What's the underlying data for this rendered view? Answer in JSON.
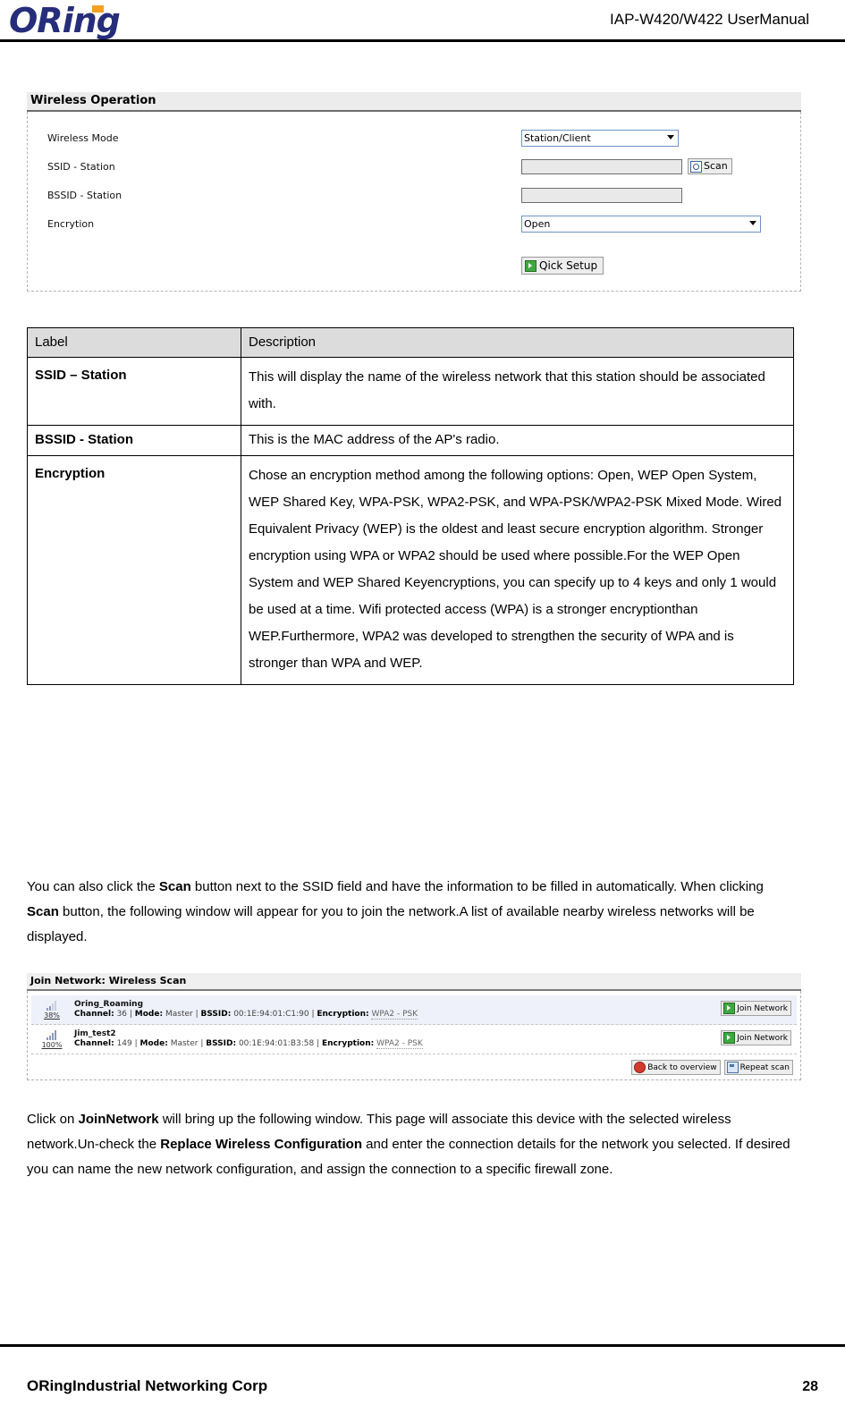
{
  "header": {
    "logo_text": "ORing",
    "doc_title": "IAP-W420/W422  UserManual"
  },
  "wireless_operation": {
    "panel_title": "Wireless Operation",
    "fields": {
      "wireless_mode": {
        "label": "Wireless Mode",
        "value": "Station/Client"
      },
      "ssid_station": {
        "label": "SSID - Station",
        "value": "",
        "scan_button": "Scan"
      },
      "bssid_station": {
        "label": "BSSID - Station",
        "value": ""
      },
      "encryption": {
        "label": "Encrytion",
        "value": "Open"
      }
    },
    "quick_setup_button": "Qick Setup"
  },
  "description_table": {
    "headers": [
      "Label",
      "Description"
    ],
    "rows": [
      {
        "label": "SSID – Station",
        "description": "This will display the name of the wireless network that this station should be associated with."
      },
      {
        "label": "BSSID - Station",
        "description": "This is the MAC address of the AP's radio."
      },
      {
        "label": "Encryption",
        "description": "Chose an encryption method among the following options: Open, WEP Open System, WEP Shared Key, WPA-PSK, WPA2-PSK, and WPA-PSK/WPA2-PSK Mixed Mode. Wired Equivalent Privacy (WEP) is the oldest and least secure encryption algorithm. Stronger encryption using WPA or WPA2 should be used where possible.For the WEP Open System and WEP Shared Keyencryptions, you can specify up to 4 keys and only 1 would be used at a time.\nWifi protected access (WPA) is a stronger encryptionthan WEP.Furthermore, WPA2 was developed to strengthen the security of WPA and is stronger than WPA and WEP."
      }
    ]
  },
  "paragraphs": {
    "scan_intro": {
      "part1": "You can also click the ",
      "bold1": "Scan",
      "part2": " button next to the SSID field and have the information to be filled in automatically. When clicking ",
      "bold2": "Scan",
      "part3": " button, the following window will appear for you to join the network.A list of available nearby wireless networks will be displayed."
    },
    "join_intro": {
      "part1": "Click on ",
      "bold1": "JoinNetwork",
      "part2": " will bring up the following window. This page will associate this device with the selected wireless network.Un-check the ",
      "bold2": "Replace Wireless Configuration",
      "part3": " and enter the connection details for the network you selected. If desired you can name the new network configuration, and assign the connection to a specific firewall zone."
    }
  },
  "wireless_scan": {
    "panel_title": "Join Network: Wireless Scan",
    "labels": {
      "channel": "Channel:",
      "mode": "Mode:",
      "bssid": "BSSID:",
      "encryption": "Encryption:"
    },
    "networks": [
      {
        "ssid": "Oring_Roaming",
        "signal": "38%",
        "channel": "36",
        "mode": "Master",
        "bssid": "00:1E:94:01:C1:90",
        "encryption": "WPA2 - PSK",
        "join_button": "Join Network"
      },
      {
        "ssid": "Jim_test2",
        "signal": "100%",
        "channel": "149",
        "mode": "Master",
        "bssid": "00:1E:94:01:B3:58",
        "encryption": "WPA2 - PSK",
        "join_button": "Join Network"
      }
    ],
    "footer_buttons": {
      "back": "Back to overview",
      "repeat": "Repeat scan"
    }
  },
  "footer": {
    "company": "ORingIndustrial Networking Corp",
    "page_number": "28"
  },
  "colors": {
    "logo_blue": "#262d7a",
    "logo_orange": "#f5a01e",
    "table_header_bg": "#dcdcdc",
    "row_highlight": "#eef0fa"
  }
}
